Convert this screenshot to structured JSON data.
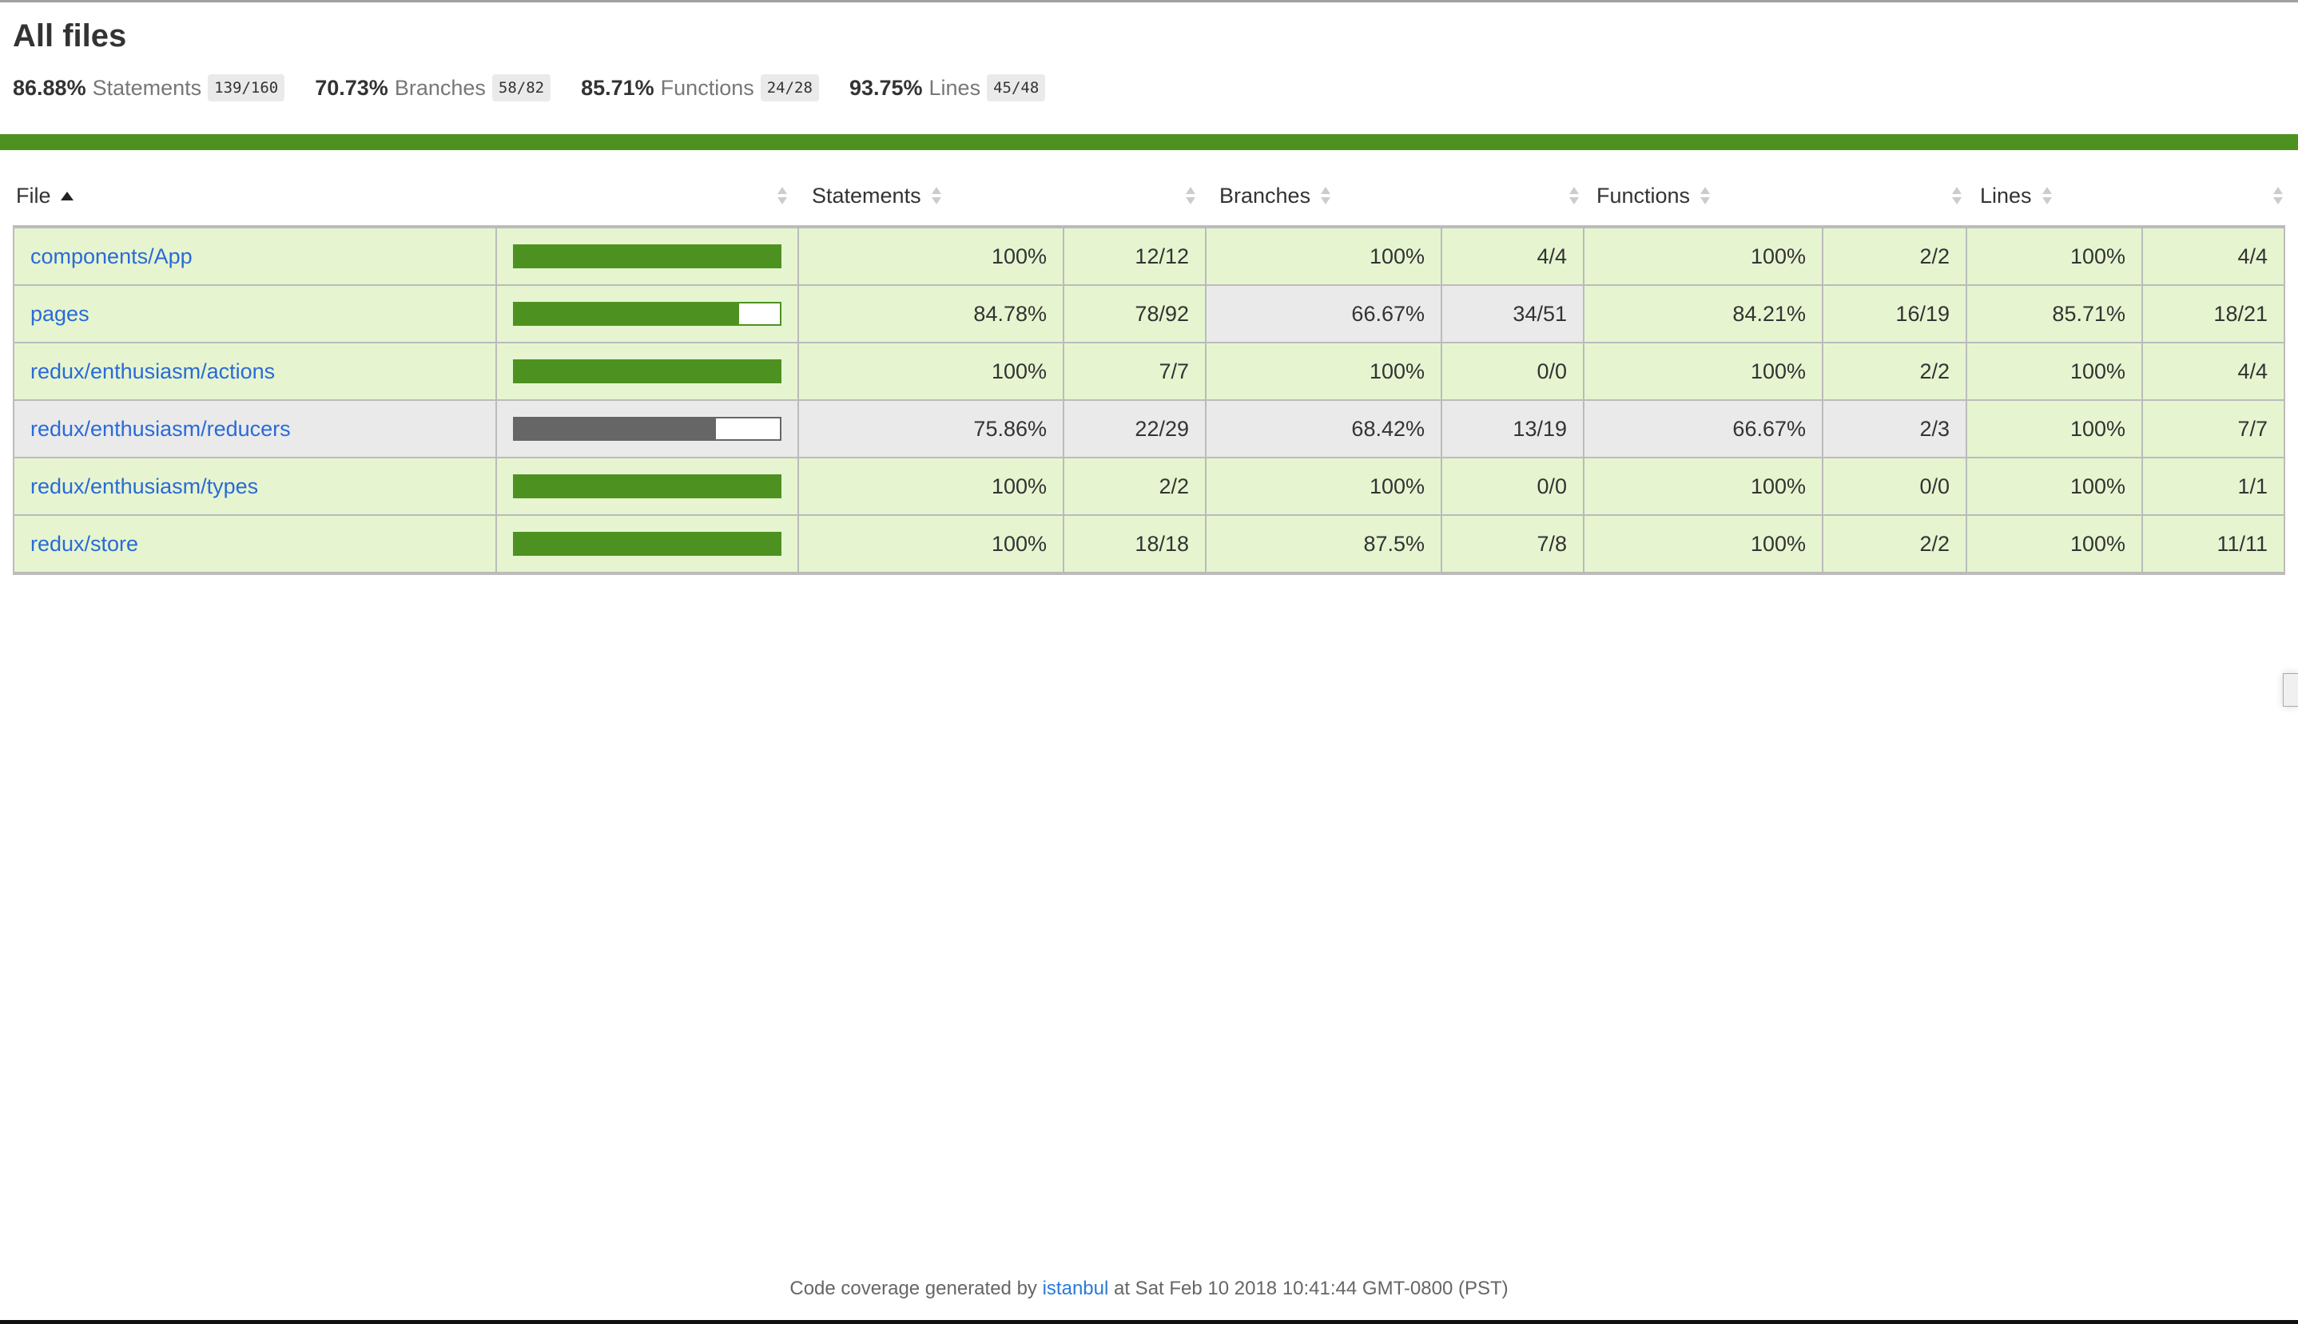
{
  "title": "All files",
  "summary": [
    {
      "pct": "86.88%",
      "label": "Statements",
      "fraction": "139/160"
    },
    {
      "pct": "70.73%",
      "label": "Branches",
      "fraction": "58/82"
    },
    {
      "pct": "85.71%",
      "label": "Functions",
      "fraction": "24/28"
    },
    {
      "pct": "93.75%",
      "label": "Lines",
      "fraction": "45/48"
    }
  ],
  "colors": {
    "high": "#e6f5d0",
    "medium": "#eaeaea",
    "bar_high": "#4d9221",
    "bar_medium": "#666666",
    "link": "#2a6ad8"
  },
  "columns": {
    "file": "File",
    "statements": "Statements",
    "branches": "Branches",
    "functions": "Functions",
    "lines": "Lines"
  },
  "sort": {
    "column": "File",
    "direction": "ascending"
  },
  "rows": [
    {
      "file": "components/App",
      "bar_percent": 100,
      "statements": {
        "pct": "100%",
        "frac": "12/12",
        "level": "high"
      },
      "branches": {
        "pct": "100%",
        "frac": "4/4",
        "level": "high"
      },
      "functions": {
        "pct": "100%",
        "frac": "2/2",
        "level": "high"
      },
      "lines": {
        "pct": "100%",
        "frac": "4/4",
        "level": "high"
      }
    },
    {
      "file": "pages",
      "bar_percent": 84.78,
      "statements": {
        "pct": "84.78%",
        "frac": "78/92",
        "level": "high"
      },
      "branches": {
        "pct": "66.67%",
        "frac": "34/51",
        "level": "medium"
      },
      "functions": {
        "pct": "84.21%",
        "frac": "16/19",
        "level": "high"
      },
      "lines": {
        "pct": "85.71%",
        "frac": "18/21",
        "level": "high"
      }
    },
    {
      "file": "redux/enthusiasm/actions",
      "bar_percent": 100,
      "statements": {
        "pct": "100%",
        "frac": "7/7",
        "level": "high"
      },
      "branches": {
        "pct": "100%",
        "frac": "0/0",
        "level": "high"
      },
      "functions": {
        "pct": "100%",
        "frac": "2/2",
        "level": "high"
      },
      "lines": {
        "pct": "100%",
        "frac": "4/4",
        "level": "high"
      }
    },
    {
      "file": "redux/enthusiasm/reducers",
      "bar_percent": 75.86,
      "statements": {
        "pct": "75.86%",
        "frac": "22/29",
        "level": "medium"
      },
      "branches": {
        "pct": "68.42%",
        "frac": "13/19",
        "level": "medium"
      },
      "functions": {
        "pct": "66.67%",
        "frac": "2/3",
        "level": "medium"
      },
      "lines": {
        "pct": "100%",
        "frac": "7/7",
        "level": "high"
      }
    },
    {
      "file": "redux/enthusiasm/types",
      "bar_percent": 100,
      "statements": {
        "pct": "100%",
        "frac": "2/2",
        "level": "high"
      },
      "branches": {
        "pct": "100%",
        "frac": "0/0",
        "level": "high"
      },
      "functions": {
        "pct": "100%",
        "frac": "0/0",
        "level": "high"
      },
      "lines": {
        "pct": "100%",
        "frac": "1/1",
        "level": "high"
      }
    },
    {
      "file": "redux/store",
      "bar_percent": 100,
      "statements": {
        "pct": "100%",
        "frac": "18/18",
        "level": "high"
      },
      "branches": {
        "pct": "87.5%",
        "frac": "7/8",
        "level": "high"
      },
      "functions": {
        "pct": "100%",
        "frac": "2/2",
        "level": "high"
      },
      "lines": {
        "pct": "100%",
        "frac": "11/11",
        "level": "high"
      }
    }
  ],
  "footer": {
    "prefix": "Code coverage generated by",
    "link": "istanbul",
    "suffix": "at Sat Feb 10 2018 10:41:44 GMT-0800 (PST)"
  }
}
